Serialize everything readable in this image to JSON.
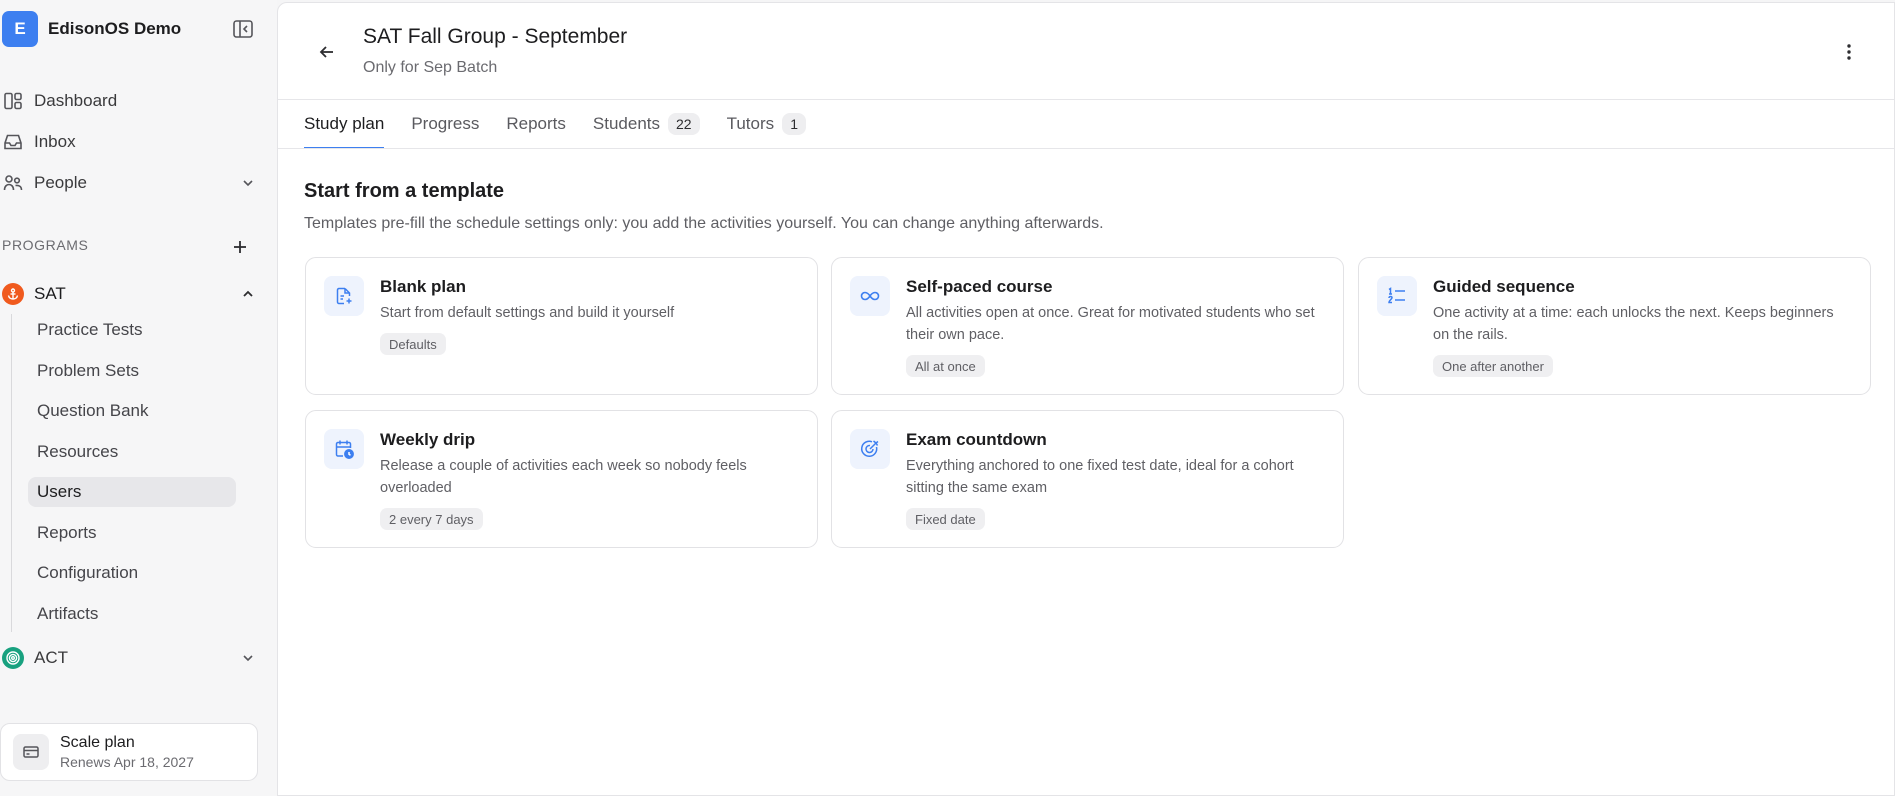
{
  "colors": {
    "accent": "#3d7ff0",
    "sat": "#f05a1e",
    "act": "#18a17f"
  },
  "sidebar": {
    "workspace": {
      "initial": "E",
      "name": "EdisonOS Demo"
    },
    "nav": [
      {
        "label": "Dashboard",
        "icon": "dashboard-icon"
      },
      {
        "label": "Inbox",
        "icon": "inbox-icon"
      },
      {
        "label": "People",
        "icon": "people-icon"
      }
    ],
    "section_label": "PROGRAMS",
    "programs": [
      {
        "label": "SAT",
        "expanded": true,
        "items": [
          "Practice Tests",
          "Problem Sets",
          "Question Bank",
          "Resources",
          "Users",
          "Reports",
          "Configuration",
          "Artifacts"
        ],
        "active_item": "Users"
      },
      {
        "label": "ACT",
        "expanded": false
      }
    ],
    "plan": {
      "title": "Scale plan",
      "subtitle": "Renews Apr 18, 2027"
    }
  },
  "header": {
    "title": "SAT Fall Group - September",
    "subtitle": "Only for Sep Batch"
  },
  "tabs": [
    {
      "label": "Study plan",
      "active": true
    },
    {
      "label": "Progress"
    },
    {
      "label": "Reports"
    },
    {
      "label": "Students",
      "count": "22"
    },
    {
      "label": "Tutors",
      "count": "1"
    }
  ],
  "templates": {
    "title": "Start from a template",
    "description": "Templates pre-fill the schedule settings only: you add the activities yourself. You can change anything afterwards.",
    "cards": [
      {
        "title": "Blank plan",
        "description": "Start from default settings and build it yourself",
        "chip": "Defaults",
        "icon": "document-plus-icon"
      },
      {
        "title": "Self-paced course",
        "description": "All activities open at once. Great for motivated students who set their own pace.",
        "chip": "All at once",
        "icon": "infinity-icon"
      },
      {
        "title": "Guided sequence",
        "description": "One activity at a time: each unlocks the next. Keeps beginners on the rails.",
        "chip": "One after another",
        "icon": "ordered-list-icon"
      },
      {
        "title": "Weekly drip",
        "description": "Release a couple of activities each week so nobody feels overloaded",
        "chip": "2 every 7 days",
        "icon": "calendar-clock-icon"
      },
      {
        "title": "Exam countdown",
        "description": "Everything anchored to one fixed test date, ideal for a cohort sitting the same exam",
        "chip": "Fixed date",
        "icon": "target-icon"
      }
    ]
  }
}
